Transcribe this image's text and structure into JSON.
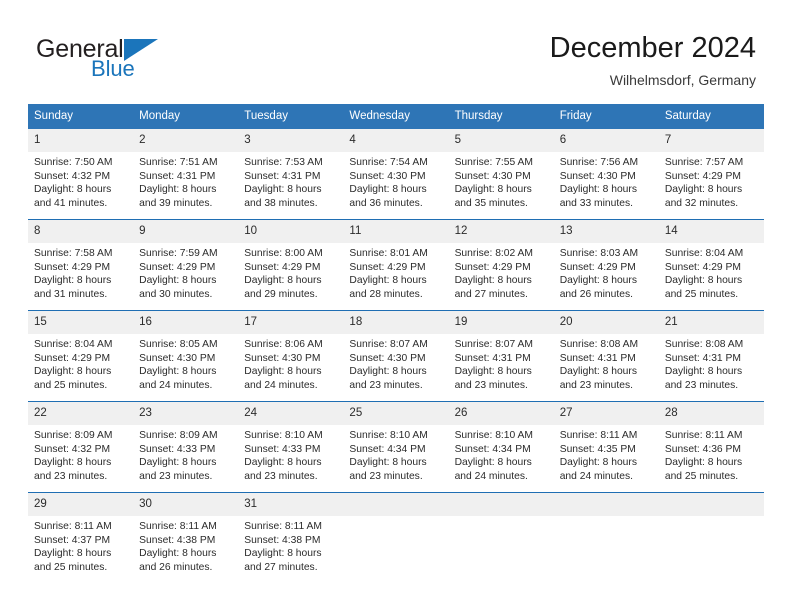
{
  "brand": {
    "name_part1": "General",
    "name_part2": "Blue",
    "triangle_icon": "triangle-icon",
    "accent_color": "#1b75bb"
  },
  "header": {
    "title": "December 2024",
    "subtitle": "Wilhelmsdorf, Germany",
    "header_bg_color": "#2e75b6",
    "header_text_color": "#ffffff"
  },
  "weekdays": [
    "Sunday",
    "Monday",
    "Tuesday",
    "Wednesday",
    "Thursday",
    "Friday",
    "Saturday"
  ],
  "weeks": [
    [
      {
        "day": "1",
        "sunrise": "Sunrise: 7:50 AM",
        "sunset": "Sunset: 4:32 PM",
        "daylight_1": "Daylight: 8 hours",
        "daylight_2": "and 41 minutes."
      },
      {
        "day": "2",
        "sunrise": "Sunrise: 7:51 AM",
        "sunset": "Sunset: 4:31 PM",
        "daylight_1": "Daylight: 8 hours",
        "daylight_2": "and 39 minutes."
      },
      {
        "day": "3",
        "sunrise": "Sunrise: 7:53 AM",
        "sunset": "Sunset: 4:31 PM",
        "daylight_1": "Daylight: 8 hours",
        "daylight_2": "and 38 minutes."
      },
      {
        "day": "4",
        "sunrise": "Sunrise: 7:54 AM",
        "sunset": "Sunset: 4:30 PM",
        "daylight_1": "Daylight: 8 hours",
        "daylight_2": "and 36 minutes."
      },
      {
        "day": "5",
        "sunrise": "Sunrise: 7:55 AM",
        "sunset": "Sunset: 4:30 PM",
        "daylight_1": "Daylight: 8 hours",
        "daylight_2": "and 35 minutes."
      },
      {
        "day": "6",
        "sunrise": "Sunrise: 7:56 AM",
        "sunset": "Sunset: 4:30 PM",
        "daylight_1": "Daylight: 8 hours",
        "daylight_2": "and 33 minutes."
      },
      {
        "day": "7",
        "sunrise": "Sunrise: 7:57 AM",
        "sunset": "Sunset: 4:29 PM",
        "daylight_1": "Daylight: 8 hours",
        "daylight_2": "and 32 minutes."
      }
    ],
    [
      {
        "day": "8",
        "sunrise": "Sunrise: 7:58 AM",
        "sunset": "Sunset: 4:29 PM",
        "daylight_1": "Daylight: 8 hours",
        "daylight_2": "and 31 minutes."
      },
      {
        "day": "9",
        "sunrise": "Sunrise: 7:59 AM",
        "sunset": "Sunset: 4:29 PM",
        "daylight_1": "Daylight: 8 hours",
        "daylight_2": "and 30 minutes."
      },
      {
        "day": "10",
        "sunrise": "Sunrise: 8:00 AM",
        "sunset": "Sunset: 4:29 PM",
        "daylight_1": "Daylight: 8 hours",
        "daylight_2": "and 29 minutes."
      },
      {
        "day": "11",
        "sunrise": "Sunrise: 8:01 AM",
        "sunset": "Sunset: 4:29 PM",
        "daylight_1": "Daylight: 8 hours",
        "daylight_2": "and 28 minutes."
      },
      {
        "day": "12",
        "sunrise": "Sunrise: 8:02 AM",
        "sunset": "Sunset: 4:29 PM",
        "daylight_1": "Daylight: 8 hours",
        "daylight_2": "and 27 minutes."
      },
      {
        "day": "13",
        "sunrise": "Sunrise: 8:03 AM",
        "sunset": "Sunset: 4:29 PM",
        "daylight_1": "Daylight: 8 hours",
        "daylight_2": "and 26 minutes."
      },
      {
        "day": "14",
        "sunrise": "Sunrise: 8:04 AM",
        "sunset": "Sunset: 4:29 PM",
        "daylight_1": "Daylight: 8 hours",
        "daylight_2": "and 25 minutes."
      }
    ],
    [
      {
        "day": "15",
        "sunrise": "Sunrise: 8:04 AM",
        "sunset": "Sunset: 4:29 PM",
        "daylight_1": "Daylight: 8 hours",
        "daylight_2": "and 25 minutes."
      },
      {
        "day": "16",
        "sunrise": "Sunrise: 8:05 AM",
        "sunset": "Sunset: 4:30 PM",
        "daylight_1": "Daylight: 8 hours",
        "daylight_2": "and 24 minutes."
      },
      {
        "day": "17",
        "sunrise": "Sunrise: 8:06 AM",
        "sunset": "Sunset: 4:30 PM",
        "daylight_1": "Daylight: 8 hours",
        "daylight_2": "and 24 minutes."
      },
      {
        "day": "18",
        "sunrise": "Sunrise: 8:07 AM",
        "sunset": "Sunset: 4:30 PM",
        "daylight_1": "Daylight: 8 hours",
        "daylight_2": "and 23 minutes."
      },
      {
        "day": "19",
        "sunrise": "Sunrise: 8:07 AM",
        "sunset": "Sunset: 4:31 PM",
        "daylight_1": "Daylight: 8 hours",
        "daylight_2": "and 23 minutes."
      },
      {
        "day": "20",
        "sunrise": "Sunrise: 8:08 AM",
        "sunset": "Sunset: 4:31 PM",
        "daylight_1": "Daylight: 8 hours",
        "daylight_2": "and 23 minutes."
      },
      {
        "day": "21",
        "sunrise": "Sunrise: 8:08 AM",
        "sunset": "Sunset: 4:31 PM",
        "daylight_1": "Daylight: 8 hours",
        "daylight_2": "and 23 minutes."
      }
    ],
    [
      {
        "day": "22",
        "sunrise": "Sunrise: 8:09 AM",
        "sunset": "Sunset: 4:32 PM",
        "daylight_1": "Daylight: 8 hours",
        "daylight_2": "and 23 minutes."
      },
      {
        "day": "23",
        "sunrise": "Sunrise: 8:09 AM",
        "sunset": "Sunset: 4:33 PM",
        "daylight_1": "Daylight: 8 hours",
        "daylight_2": "and 23 minutes."
      },
      {
        "day": "24",
        "sunrise": "Sunrise: 8:10 AM",
        "sunset": "Sunset: 4:33 PM",
        "daylight_1": "Daylight: 8 hours",
        "daylight_2": "and 23 minutes."
      },
      {
        "day": "25",
        "sunrise": "Sunrise: 8:10 AM",
        "sunset": "Sunset: 4:34 PM",
        "daylight_1": "Daylight: 8 hours",
        "daylight_2": "and 23 minutes."
      },
      {
        "day": "26",
        "sunrise": "Sunrise: 8:10 AM",
        "sunset": "Sunset: 4:34 PM",
        "daylight_1": "Daylight: 8 hours",
        "daylight_2": "and 24 minutes."
      },
      {
        "day": "27",
        "sunrise": "Sunrise: 8:11 AM",
        "sunset": "Sunset: 4:35 PM",
        "daylight_1": "Daylight: 8 hours",
        "daylight_2": "and 24 minutes."
      },
      {
        "day": "28",
        "sunrise": "Sunrise: 8:11 AM",
        "sunset": "Sunset: 4:36 PM",
        "daylight_1": "Daylight: 8 hours",
        "daylight_2": "and 25 minutes."
      }
    ],
    [
      {
        "day": "29",
        "sunrise": "Sunrise: 8:11 AM",
        "sunset": "Sunset: 4:37 PM",
        "daylight_1": "Daylight: 8 hours",
        "daylight_2": "and 25 minutes."
      },
      {
        "day": "30",
        "sunrise": "Sunrise: 8:11 AM",
        "sunset": "Sunset: 4:38 PM",
        "daylight_1": "Daylight: 8 hours",
        "daylight_2": "and 26 minutes."
      },
      {
        "day": "31",
        "sunrise": "Sunrise: 8:11 AM",
        "sunset": "Sunset: 4:38 PM",
        "daylight_1": "Daylight: 8 hours",
        "daylight_2": "and 27 minutes."
      },
      {
        "day": "",
        "sunrise": "",
        "sunset": "",
        "daylight_1": "",
        "daylight_2": ""
      },
      {
        "day": "",
        "sunrise": "",
        "sunset": "",
        "daylight_1": "",
        "daylight_2": ""
      },
      {
        "day": "",
        "sunrise": "",
        "sunset": "",
        "daylight_1": "",
        "daylight_2": ""
      },
      {
        "day": "",
        "sunrise": "",
        "sunset": "",
        "daylight_1": "",
        "daylight_2": ""
      }
    ]
  ]
}
